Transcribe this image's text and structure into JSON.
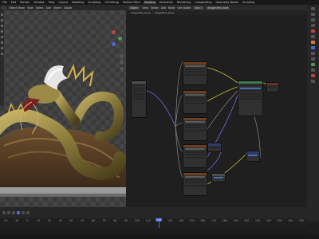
{
  "topbar": {
    "items": [
      "File",
      "Edit",
      "Render",
      "Window",
      "Help",
      "Layout",
      "Modeling",
      "Sculpting",
      "UV Editing",
      "Texture Paint",
      "Shading",
      "Animation",
      "Rendering",
      "Compositing",
      "Geometry Nodes",
      "Scripting"
    ],
    "active_index": 10,
    "scene": "Scene",
    "view_layer": "ViewLayer"
  },
  "viewport": {
    "mode": "Object Mode",
    "menus": [
      "View",
      "Select",
      "Add",
      "Object"
    ],
    "shading": "Global"
  },
  "node_editor": {
    "type": "Object",
    "menus": [
      "View",
      "Select",
      "Add",
      "Node"
    ],
    "use_nodes": "Use Nodes",
    "slot": "Slot 1",
    "material": "dragonfire_bone",
    "breadcrumb": [
      "dragonfire_bone",
      "dragonfire_bone"
    ]
  },
  "timeline": {
    "ticks": [
      "-20",
      "-10",
      "0",
      "10",
      "20",
      "30",
      "40",
      "50",
      "60",
      "70",
      "80",
      "90",
      "100",
      "110",
      "120",
      "130",
      "140",
      "150",
      "160",
      "170",
      "180",
      "190",
      "200",
      "210",
      "220",
      "230",
      "240",
      "250"
    ],
    "current_frame": "120",
    "current_index": 14
  },
  "statusbar": {
    "text": ""
  },
  "colors": {
    "accent": "#4a6bd6",
    "node_header_texture": "#6b3d21",
    "node_header_vector": "#2d3a6b",
    "link_yellow": "#c7c22e",
    "link_purple": "#7a6ad6",
    "link_grey": "#9a9a9a"
  }
}
